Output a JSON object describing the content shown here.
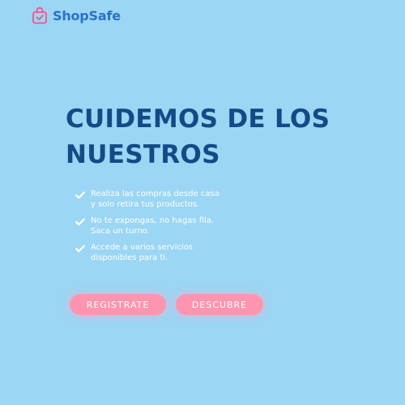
{
  "brand": {
    "name": "ShopSafe",
    "icon": "shopping-bag-check-icon",
    "icon_color": "#f0558a",
    "text_color": "#2b71c9"
  },
  "hero": {
    "title_line1": "CUIDEMOS DE LOS",
    "title_line2": "NUESTROS",
    "title_color": "#144a86"
  },
  "features": [
    {
      "icon": "check-icon",
      "line1": "Realiza las compras desde casa",
      "line2": "y solo retira tus productos."
    },
    {
      "icon": "check-icon",
      "line1": "No te expongas, no hagas fila.",
      "line2": "Saca un turno."
    },
    {
      "icon": "check-icon",
      "line1": "Accede a varios servicios",
      "line2": "disponibles para ti."
    }
  ],
  "actions": {
    "register_label": "REGISTRATE",
    "discover_label": "DESCUBRE",
    "button_color": "#fd95b0"
  },
  "colors": {
    "background": "#9bd6f4"
  }
}
